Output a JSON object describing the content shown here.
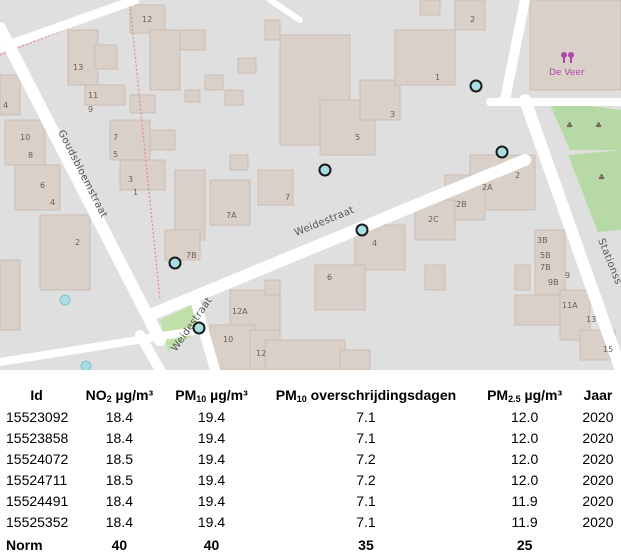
{
  "map": {
    "streets": [
      "Weidestraat",
      "Weidestraat",
      "Goudsbloemstraat",
      "Stationss"
    ],
    "poi_label": "De Veer",
    "house_numbers": [
      "12",
      "13",
      "11",
      "9",
      "7",
      "5",
      "3",
      "1",
      "4",
      "10",
      "8",
      "6",
      "4",
      "2",
      "7B",
      "7A",
      "7",
      "5",
      "3",
      "1",
      "2",
      "2A",
      "2B",
      "2C",
      "4",
      "3B",
      "5B",
      "7B",
      "9B",
      "9",
      "11A",
      "13",
      "15",
      "12A",
      "10",
      "12",
      "6",
      "2"
    ],
    "colors": {
      "background": "#e0dfdf",
      "building": "#d9d0c9",
      "road": "#ffffff",
      "park": "#b7d9a5",
      "marker": "#a8dde2",
      "poi": "#ad46a9"
    }
  },
  "table": {
    "headers": [
      {
        "main": "Id",
        "sub": "",
        "unit": ""
      },
      {
        "main": "NO",
        "sub": "2",
        "unit": " µg/m³"
      },
      {
        "main": "PM",
        "sub": "10",
        "unit": " µg/m³"
      },
      {
        "main": "PM",
        "sub": "10",
        "unit": " overschrijdingsdagen"
      },
      {
        "main": "PM",
        "sub": "2.5",
        "unit": " µg/m³"
      },
      {
        "main": "Jaar",
        "sub": "",
        "unit": ""
      }
    ],
    "rows": [
      [
        "15523092",
        "18.4",
        "19.4",
        "7.1",
        "12.0",
        "2020"
      ],
      [
        "15523858",
        "18.4",
        "19.4",
        "7.1",
        "12.0",
        "2020"
      ],
      [
        "15524072",
        "18.5",
        "19.4",
        "7.2",
        "12.0",
        "2020"
      ],
      [
        "15524711",
        "18.5",
        "19.4",
        "7.2",
        "12.0",
        "2020"
      ],
      [
        "15524491",
        "18.4",
        "19.4",
        "7.1",
        "11.9",
        "2020"
      ],
      [
        "15525352",
        "18.4",
        "19.4",
        "7.1",
        "11.9",
        "2020"
      ]
    ],
    "norm": [
      "Norm",
      "40",
      "40",
      "35",
      "25",
      ""
    ]
  }
}
